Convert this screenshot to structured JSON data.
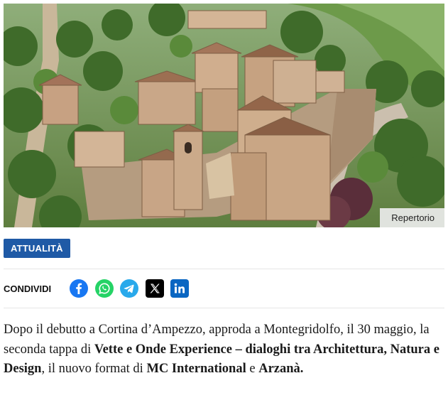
{
  "hero": {
    "image_name": "aerial-photo-medieval-village-montegridolfo",
    "credit": "Repertorio"
  },
  "article": {
    "category": "ATTUALITÀ",
    "share_label": "CONDIVIDI",
    "share_buttons": [
      {
        "name": "facebook",
        "color": "#1877f2"
      },
      {
        "name": "whatsapp",
        "color": "#25d366"
      },
      {
        "name": "telegram",
        "color": "#29a9eb"
      },
      {
        "name": "x",
        "color": "#000000"
      },
      {
        "name": "linkedin",
        "color": "#0a66c2"
      }
    ],
    "paragraph": {
      "t1": "Dopo il debutto a Cortina d’Ampezzo, approda a Montegridolfo, il 30 maggio, la seconda tappa di ",
      "b1": "Vette e Onde Experience – dialoghi tra Architettura, Natura e Design",
      "t2": ", il nuovo format di ",
      "b2": "MC International",
      "t3": " e ",
      "b3": "Arzanà."
    }
  }
}
